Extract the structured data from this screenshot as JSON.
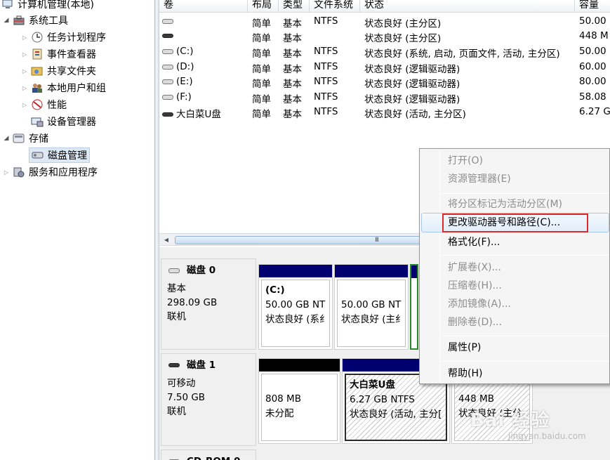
{
  "tree": {
    "items": [
      {
        "label": "计算机管理(本地)"
      },
      {
        "label": "系统工具"
      },
      {
        "label": "任务计划程序"
      },
      {
        "label": "事件查看器"
      },
      {
        "label": "共享文件夹"
      },
      {
        "label": "本地用户和组"
      },
      {
        "label": "性能"
      },
      {
        "label": "设备管理器"
      },
      {
        "label": "存储"
      },
      {
        "label": "磁盘管理"
      },
      {
        "label": "服务和应用程序"
      }
    ]
  },
  "volume_list": {
    "columns": [
      "卷",
      "布局",
      "类型",
      "文件系统",
      "状态",
      "容量"
    ],
    "rows": [
      {
        "vol": "",
        "layout": "简单",
        "type": "基本",
        "fs": "NTFS",
        "status": "状态良好 (主分区)",
        "cap": "50.00"
      },
      {
        "vol": "",
        "layout": "简单",
        "type": "基本",
        "fs": "",
        "status": "状态良好 (主分区)",
        "cap": "448 M"
      },
      {
        "vol": "(C:)",
        "layout": "简单",
        "type": "基本",
        "fs": "NTFS",
        "status": "状态良好 (系统, 启动, 页面文件, 活动, 主分区)",
        "cap": "50.00"
      },
      {
        "vol": "(D:)",
        "layout": "简单",
        "type": "基本",
        "fs": "NTFS",
        "status": "状态良好 (逻辑驱动器)",
        "cap": "60.00"
      },
      {
        "vol": "(E:)",
        "layout": "简单",
        "type": "基本",
        "fs": "NTFS",
        "status": "状态良好 (逻辑驱动器)",
        "cap": "80.00"
      },
      {
        "vol": "(F:)",
        "layout": "简单",
        "type": "基本",
        "fs": "NTFS",
        "status": "状态良好 (逻辑驱动器)",
        "cap": "58.08"
      },
      {
        "vol": "大白菜U盘",
        "layout": "简单",
        "type": "基本",
        "fs": "NTFS",
        "status": "状态良好 (活动, 主分区)",
        "cap": "6.27 G"
      }
    ]
  },
  "scrollbar": {
    "grip": "III"
  },
  "disks": [
    {
      "name": "磁盘 0",
      "kind": "基本",
      "size": "298.09 GB",
      "state": "联机"
    },
    {
      "name": "磁盘 1",
      "kind": "可移动",
      "size": "7.50 GB",
      "state": "联机"
    },
    {
      "name": "CD-ROM 0"
    }
  ],
  "partitions": {
    "disk0": [
      {
        "title": "(C:)",
        "size": "50.00 GB NT",
        "status": "状态良好 (系纟"
      },
      {
        "title": "",
        "size": "50.00 GB NT",
        "status": "状态良好 (主纟"
      }
    ],
    "disk1": [
      {
        "title": "",
        "size": "808 MB",
        "status": "未分配"
      },
      {
        "title": "大白菜U盘",
        "size": "6.27 GB NTFS",
        "status": "状态良好 (活动, 主分["
      },
      {
        "title": "",
        "size": "448 MB",
        "status": "状态良好 (主分"
      }
    ]
  },
  "context_menu": {
    "items": [
      {
        "label": "打开(O)",
        "enabled": false
      },
      {
        "label": "资源管理器(E)",
        "enabled": false
      },
      {
        "label": "将分区标记为活动分区(M)",
        "enabled": false
      },
      {
        "label": "更改驱动器号和路径(C)...",
        "enabled": true
      },
      {
        "label": "格式化(F)...",
        "enabled": true
      },
      {
        "label": "扩展卷(X)...",
        "enabled": false
      },
      {
        "label": "压缩卷(H)...",
        "enabled": false
      },
      {
        "label": "添加镜像(A)...",
        "enabled": false
      },
      {
        "label": "删除卷(D)...",
        "enabled": false
      },
      {
        "label": "属性(P)",
        "enabled": true
      },
      {
        "label": "帮助(H)",
        "enabled": true
      }
    ]
  },
  "watermark": {
    "brand": "Bai 经验",
    "url": "jingyan.baidu.com"
  },
  "colors": {
    "partition_bar": "#000070",
    "unallocated_bar": "#000000",
    "highlight_box": "#e02a2a"
  }
}
